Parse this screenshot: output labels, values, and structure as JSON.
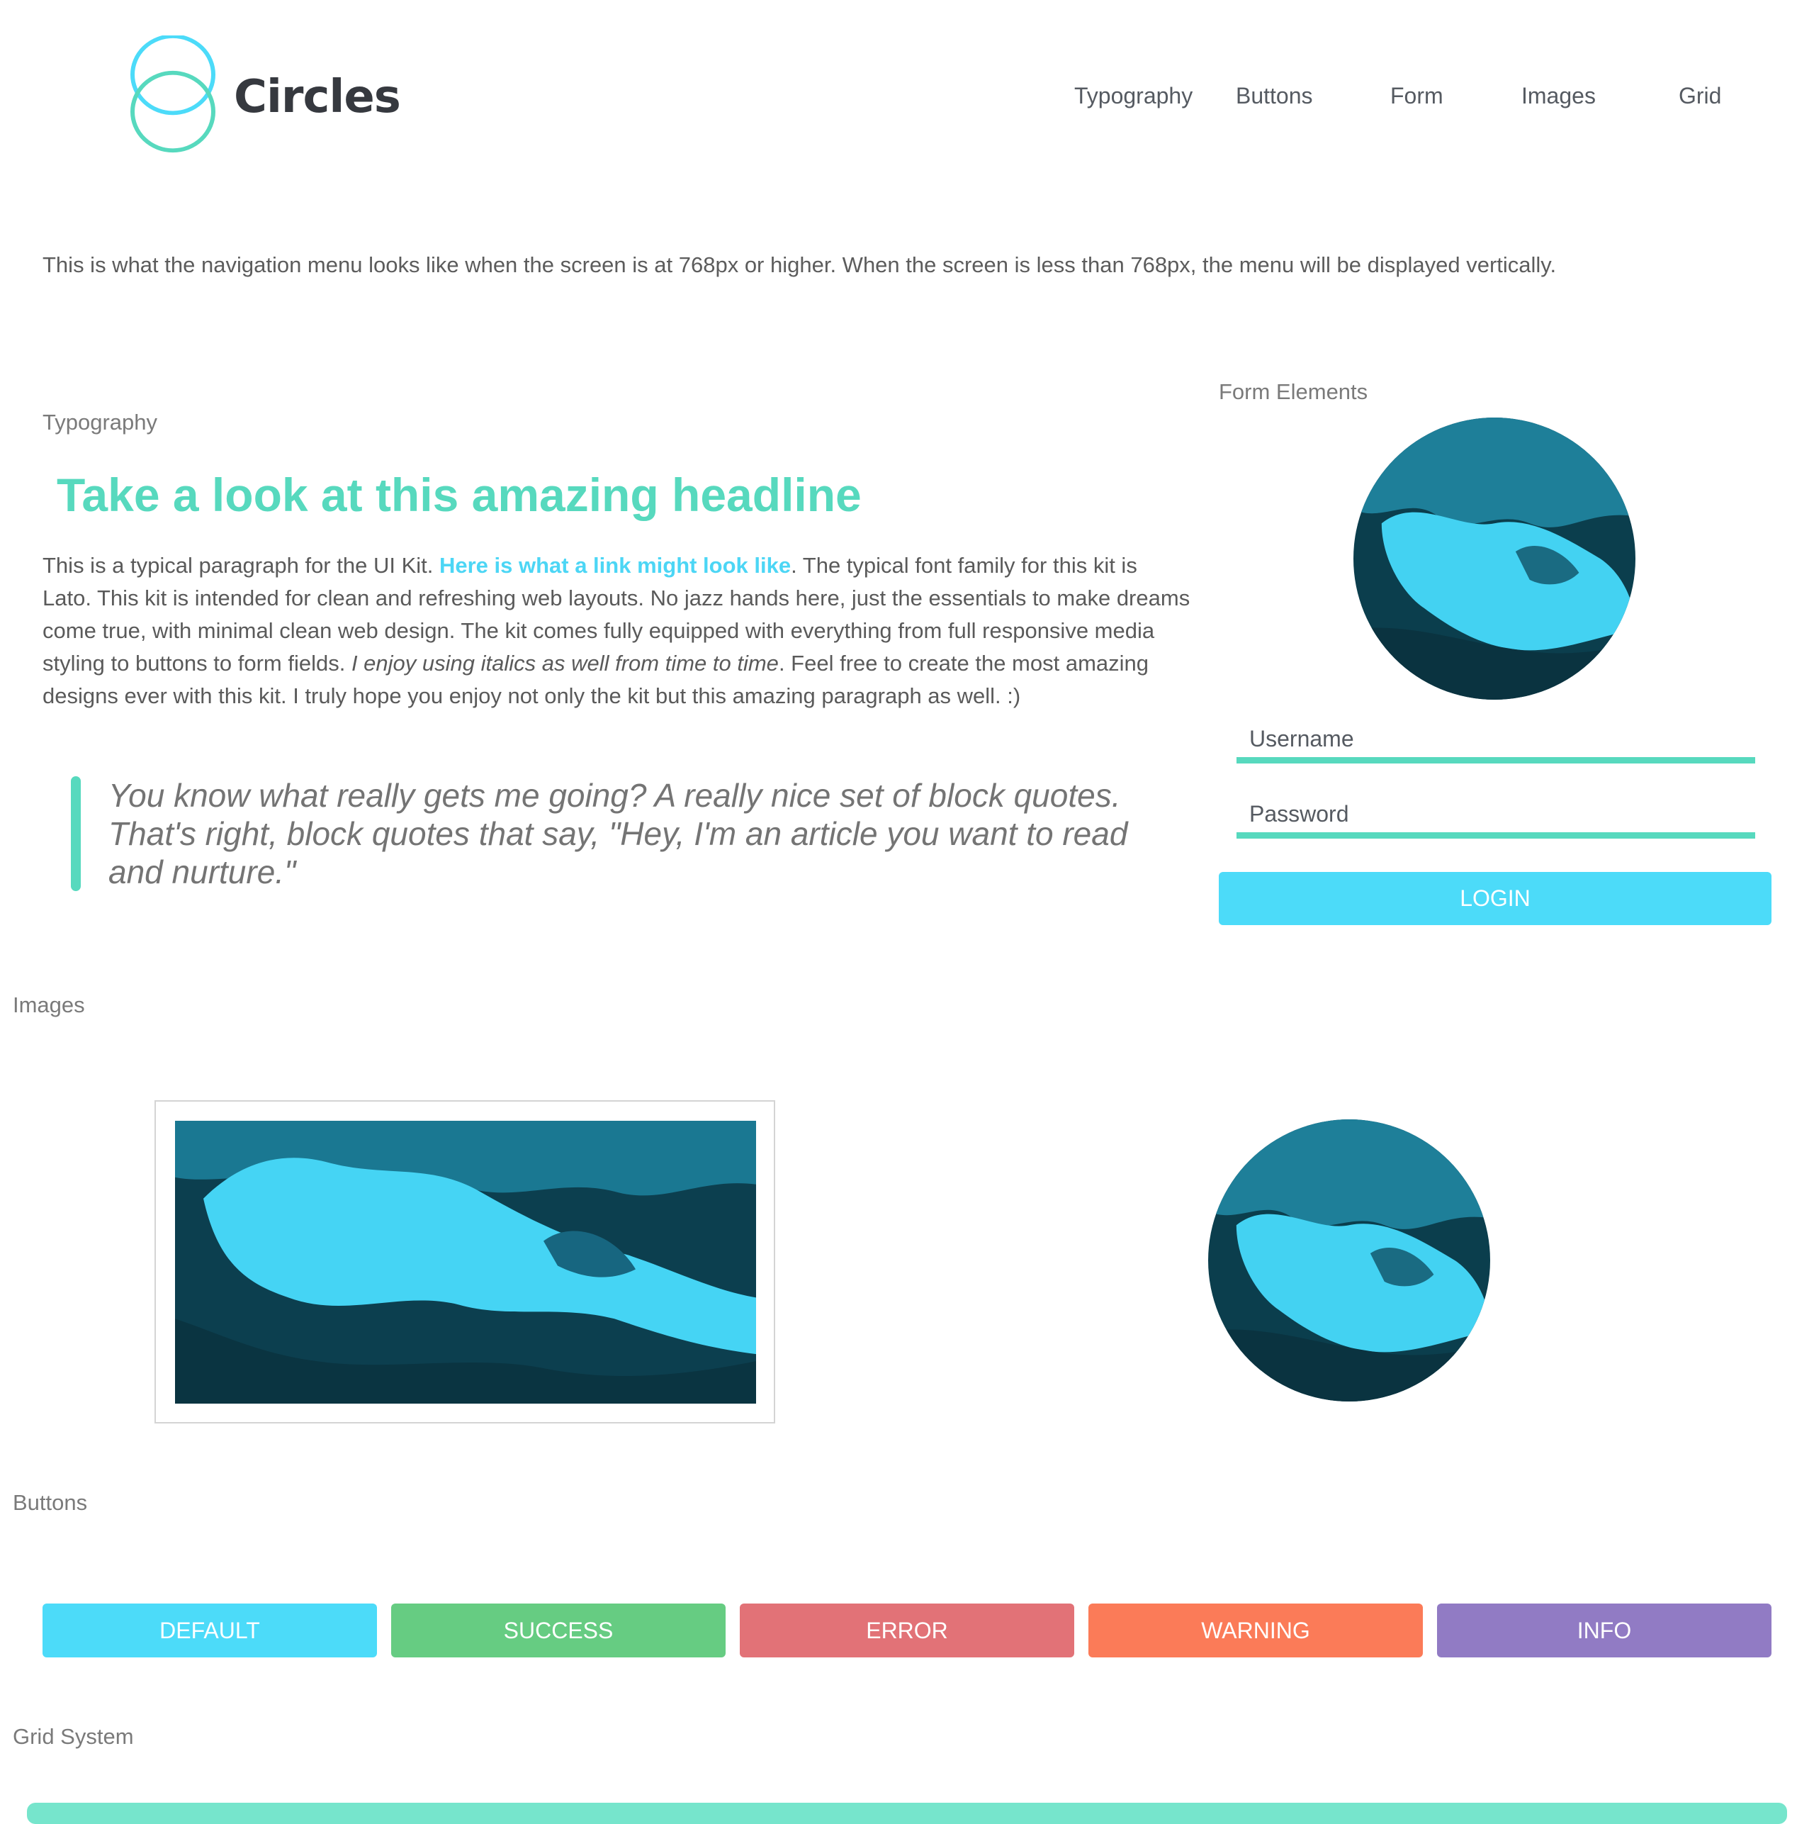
{
  "brand": {
    "name": "Circles",
    "logo_icon": "two-overlapping-circles-icon",
    "logo_colors": [
      "#4cdbf9",
      "#57d9be"
    ]
  },
  "nav": {
    "items": [
      {
        "label": "Typography"
      },
      {
        "label": "Buttons"
      },
      {
        "label": "Form"
      },
      {
        "label": "Images"
      },
      {
        "label": "Grid"
      }
    ]
  },
  "intro_text": "This is what the navigation menu looks like when the screen is at 768px or higher. When the screen is less than 768px, the menu will be displayed vertically.",
  "typography": {
    "label": "Typography",
    "headline": "Take a look at this amazing headline",
    "para_part1": "This is a typical paragraph for the UI Kit. ",
    "link_text": "Here is what a link might look like",
    "para_part2": ". The typical font family for this kit is Lato. This kit is intended for clean and refreshing web layouts. No jazz hands here, just the essentials to make dreams come true, with minimal clean web design. The kit comes fully equipped with everything from full responsive media styling to buttons to form fields. ",
    "italic_text": "I enjoy using italics as well from time to time",
    "para_part3": ". Feel free to create the most amazing designs ever with this kit. I truly hope you enjoy not only the kit but this amazing paragraph as well. :)",
    "blockquote": "You know what really gets me going? A really nice set of block quotes. That's right, block quotes that say, \"Hey, I'm an article you want to read and nurture.\""
  },
  "form": {
    "label": "Form Elements",
    "username_placeholder": "Username",
    "username_value": "",
    "password_placeholder": "Password",
    "password_value": "",
    "login_label": "LOGIN"
  },
  "images": {
    "label": "Images"
  },
  "buttons": {
    "label": "Buttons",
    "items": [
      {
        "label": "DEFAULT",
        "color": "#4cdbf9"
      },
      {
        "label": "SUCCESS",
        "color": "#66cc82"
      },
      {
        "label": "ERROR",
        "color": "#e27277"
      },
      {
        "label": "WARNING",
        "color": "#fb7b58"
      },
      {
        "label": "INFO",
        "color": "#917bc4"
      }
    ]
  },
  "grid": {
    "label": "Grid System"
  },
  "colors": {
    "accent": "#57d9be",
    "link": "#4cd6f5",
    "text": "#555555"
  }
}
